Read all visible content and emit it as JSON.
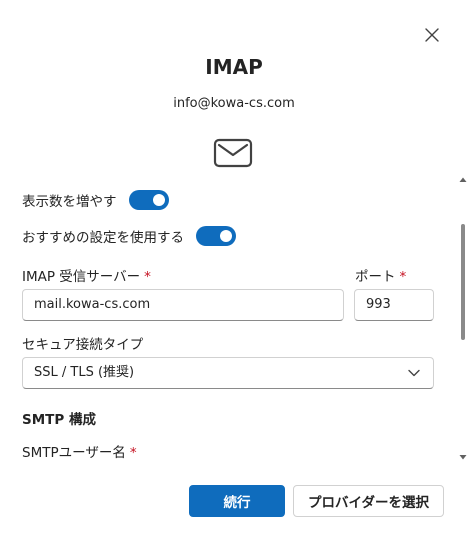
{
  "dialog": {
    "title": "IMAP",
    "email": "info@kowa-cs.com",
    "close_icon": "close-icon",
    "mail_icon": "mail-icon"
  },
  "form": {
    "show_more_label": "表示数を増やす",
    "show_more_on": true,
    "recommended_label": "おすすめの設定を使用する",
    "recommended_on": true,
    "imap_server_label": "IMAP 受信サーバー",
    "imap_server_value": "mail.kowa-cs.com",
    "port_label": "ポート",
    "port_value": "993",
    "secure_conn_label": "セキュア接続タイプ",
    "secure_conn_value": "SSL / TLS (推奨)",
    "smtp_section_title": "SMTP 構成",
    "smtp_user_label": "SMTPユーザー名",
    "required_mark": "*"
  },
  "actions": {
    "continue_label": "続行",
    "choose_provider_label": "プロバイダーを選択"
  },
  "colors": {
    "accent": "#0f6cbd",
    "required": "#c50f1f",
    "text": "#242424",
    "border": "#d1d1d1"
  }
}
